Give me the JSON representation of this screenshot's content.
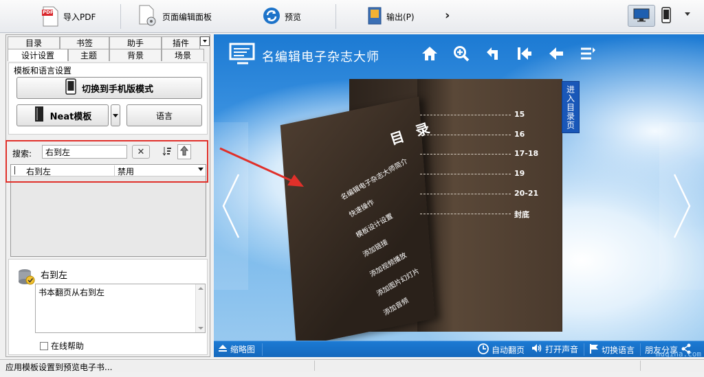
{
  "toolbar": {
    "import_pdf": "导入PDF",
    "page_editor": "页面编辑面板",
    "preview": "预览",
    "output": "输出(P)",
    "more_icon": "chevron-right",
    "pdf_badge": "PDF"
  },
  "tabs": {
    "row1": [
      "目录",
      "书签",
      "助手",
      "插件"
    ],
    "row2": [
      "设计设置",
      "主题",
      "背景",
      "场景"
    ]
  },
  "template_group": {
    "title": "模板和语言设置",
    "switch_mobile": "切换到手机版模式",
    "template_name": "Neat模板",
    "language": "语言"
  },
  "search": {
    "label": "搜索:",
    "value": "右到左"
  },
  "property": {
    "name": "右到左",
    "value": "禁用"
  },
  "help": {
    "title": "右到左",
    "text": "书本翻页从右到左",
    "online_help": "在线帮助"
  },
  "preview": {
    "brand": "名编辑电子杂志大师",
    "bookmark_tab": "进入目录页",
    "toc_title": "目 录",
    "toc_items": [
      "名编辑电子杂志大师简介",
      "快速操作",
      "模板设计设置",
      "添加链接",
      "添加视频播放",
      "添加图片幻灯片",
      "添加音频"
    ],
    "toc_pages": [
      "15",
      "16",
      "17-18",
      "19",
      "20-21",
      "封底"
    ],
    "thumbnail": "缩略图",
    "auto_flip": "自动翻页",
    "sound": "打开声音",
    "switch_language": "切换语言",
    "share": "朋友分享",
    "watermark": "muqina.com"
  },
  "status": {
    "text": "应用模板设置到预览电子书..."
  },
  "colors": {
    "accent_red": "#e0302a",
    "preview_blue": "#1c7ad3"
  }
}
